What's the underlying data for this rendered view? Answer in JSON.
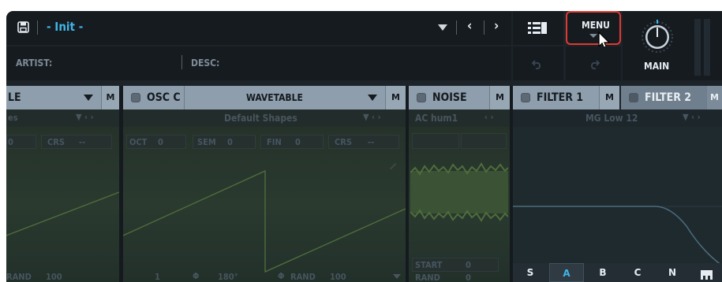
{
  "header": {
    "preset_name": "- Init -",
    "artist_label": "ARTIST:",
    "desc_label": "DESC:",
    "menu_label": "MENU",
    "main_label": "MAIN"
  },
  "modules": {
    "osc_b": {
      "type_label": "LE",
      "m": "M",
      "wavetable": "es",
      "crs": "CRS",
      "rand": "RAND",
      "rand_value": "100",
      "zero": "0",
      "dash": "--"
    },
    "osc_c": {
      "title": "OSC C",
      "type_label": "WAVETABLE",
      "m": "M",
      "wavetable": "Default Shapes",
      "oct_label": "OCT",
      "oct_value": "0",
      "sem_label": "SEM",
      "sem_value": "0",
      "fin_label": "FIN",
      "fin_value": "0",
      "crs_label": "CRS",
      "crs_value": "--",
      "bottom_1": "1",
      "phase_label": "180°",
      "rand_label": "RAND",
      "rand_value": "100"
    },
    "noise": {
      "title": "NOISE",
      "m": "M",
      "sample": "AC hum1",
      "start_label": "START",
      "start_value": "0",
      "rand_label": "RAND",
      "rand_value": "0"
    },
    "filter1": {
      "title": "FILTER 1",
      "m": "M",
      "type": "MG Low 12",
      "buttons": [
        "S",
        "A",
        "B",
        "C",
        "N"
      ],
      "active": "A"
    },
    "filter2": {
      "title": "FILTER 2",
      "m": "M"
    }
  },
  "colors": {
    "accent": "#3fb5e6",
    "menu_outline": "#e0392f",
    "wave": "#4f6d3c"
  }
}
